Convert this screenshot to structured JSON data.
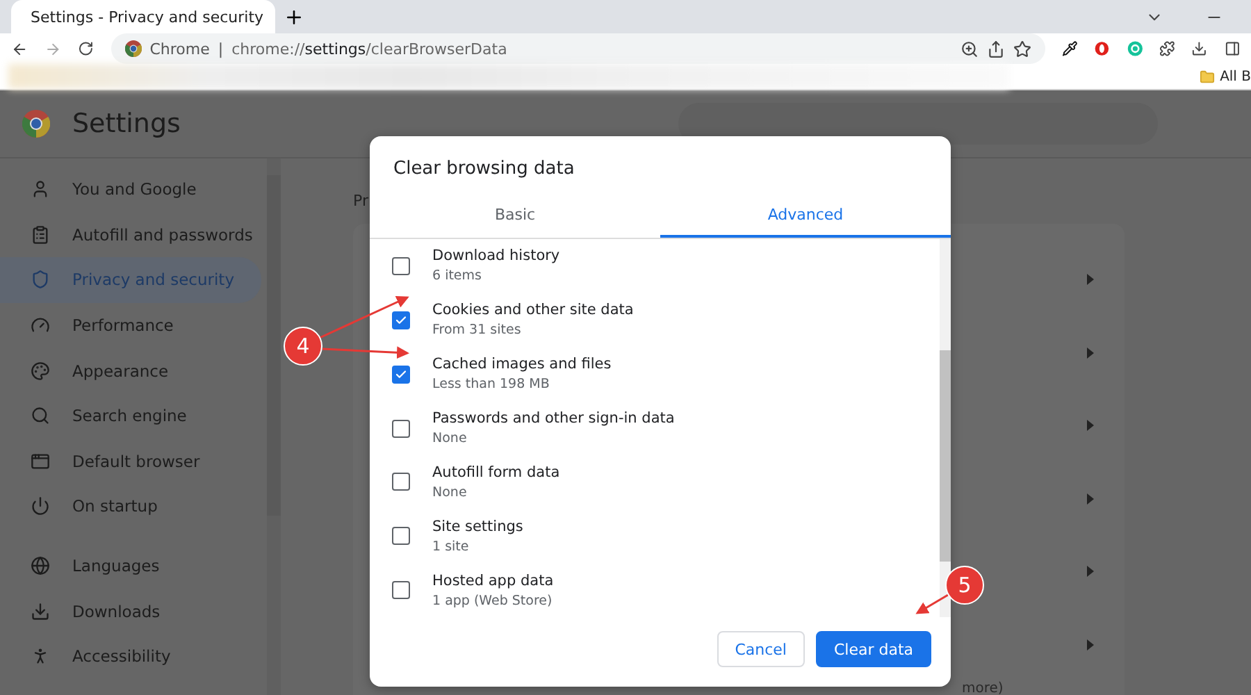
{
  "browser": {
    "tab_title": "Settings - Privacy and security",
    "omnibox_label": "Chrome",
    "separator": "|",
    "url": "chrome://**settings**/clearBrowserData",
    "bookmarks_overflow": "All B"
  },
  "settings": {
    "title": "Settings",
    "sidebar": {
      "items": [
        {
          "label": "You and Google",
          "selected": false
        },
        {
          "label": "Autofill and passwords",
          "selected": false
        },
        {
          "label": "Privacy and security",
          "selected": true
        },
        {
          "label": "Performance",
          "selected": false
        },
        {
          "label": "Appearance",
          "selected": false
        },
        {
          "label": "Search engine",
          "selected": false
        },
        {
          "label": "Default browser",
          "selected": false
        },
        {
          "label": "On startup",
          "selected": false
        },
        {
          "label": "Languages",
          "selected": false
        },
        {
          "label": "Downloads",
          "selected": false
        },
        {
          "label": "Accessibility",
          "selected": false
        }
      ]
    },
    "main": {
      "heading": "Pr",
      "footer_text": "more)"
    }
  },
  "dialog": {
    "title": "Clear browsing data",
    "tabs": [
      {
        "label": "Basic",
        "selected": false
      },
      {
        "label": "Advanced",
        "selected": true
      }
    ],
    "items": [
      {
        "label": "Download history",
        "detail": "6 items",
        "checked": false
      },
      {
        "label": "Cookies and other site data",
        "detail": "From 31 sites",
        "checked": true
      },
      {
        "label": "Cached images and files",
        "detail": "Less than 198 MB",
        "checked": true
      },
      {
        "label": "Passwords and other sign-in data",
        "detail": "None",
        "checked": false
      },
      {
        "label": "Autofill form data",
        "detail": "None",
        "checked": false
      },
      {
        "label": "Site settings",
        "detail": "1 site",
        "checked": false
      },
      {
        "label": "Hosted app data",
        "detail": "1 app (Web Store)",
        "checked": false
      }
    ],
    "buttons": [
      {
        "label": "Cancel",
        "kind": "secondary"
      },
      {
        "label": "Clear data",
        "kind": "primary"
      }
    ]
  },
  "annotations": [
    {
      "label": "4"
    },
    {
      "label": "5"
    }
  ]
}
